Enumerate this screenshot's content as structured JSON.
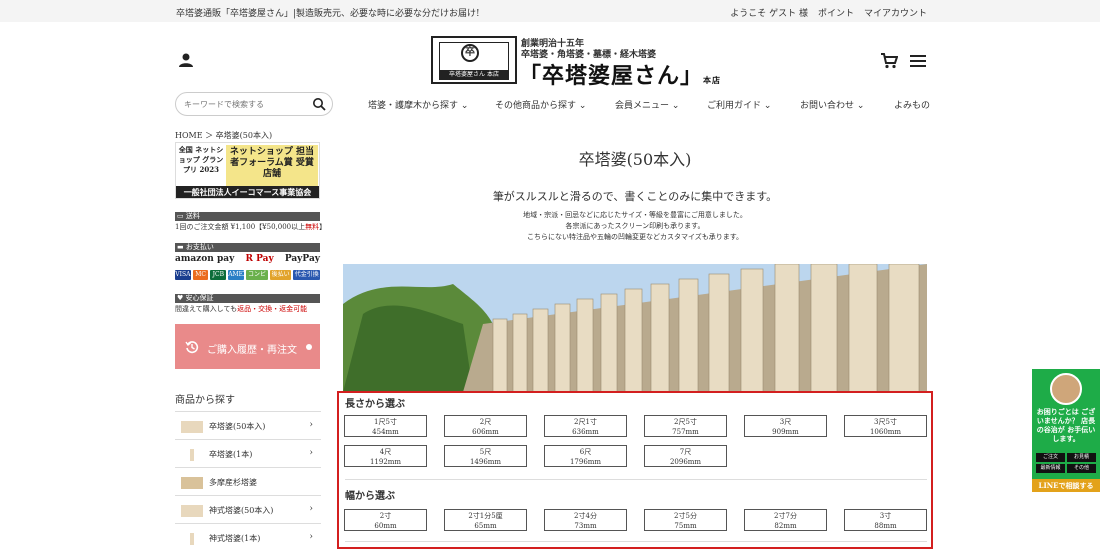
{
  "topbar": {
    "tagline": "卒塔婆通販「卒塔婆屋さん」|製造販売元、必要な時に必要な分だけお届け!",
    "welcome": "ようこそ ゲスト 様",
    "points": "ポイント",
    "my_account": "マイアカウント"
  },
  "logo": {
    "line1": "創業明治十五年",
    "line2": "卒塔婆・角塔婆・墓標・経木塔婆",
    "name": "「卒塔婆屋さん」",
    "suffix": "本店",
    "seal_text": "卒塔婆屋さん 本店",
    "seal_char": "卒"
  },
  "search": {
    "placeholder": "キーワードで検索する"
  },
  "nav": [
    {
      "label": "塔婆・護摩木から探す ⌄"
    },
    {
      "label": "その他商品から探す ⌄"
    },
    {
      "label": "会員メニュー ⌄"
    },
    {
      "label": "ご利用ガイド ⌄"
    },
    {
      "label": "お問い合わせ ⌄"
    },
    {
      "label": "よみもの"
    }
  ],
  "breadcrumb": "HOME ＞ 卒塔婆(50本入)",
  "award": {
    "left": "全国 ネットショップ グランプリ 2023",
    "badge": "ネットショップ 担当者フォーラム賞 受賞店舗",
    "foot": "一般社団法人イーコマース事業協会"
  },
  "sidebar": {
    "shipping_head": "送料",
    "shipping_text_a": "1回のご注文金額 ¥1,100【¥50,000以上",
    "shipping_text_b": "無料",
    "shipping_text_c": "】",
    "payment_head": "お支払い",
    "pay1": "amazon pay",
    "pay2": "R Pay",
    "pay3": "PayPay",
    "pay_mini": [
      "VISA",
      "MC",
      "JCB",
      "AMEX",
      "コンビニ",
      "後払い",
      "代金引換"
    ],
    "secure_head": "安心保証",
    "secure_text_a": "間違えて購入しても",
    "secure_text_b": "返品・交換・返金可能",
    "history_button": "ご購入履歴・再注文",
    "cat_title": "商品から探す",
    "categories": [
      {
        "label": "卒塔婆(50本入)"
      },
      {
        "label": "卒塔婆(1本)"
      },
      {
        "label": "多摩産杉塔婆"
      },
      {
        "label": "神式塔婆(50本入)"
      },
      {
        "label": "神式塔婆(1本)"
      }
    ]
  },
  "main": {
    "title": "卒塔婆(50本入)",
    "lead": "筆がスルスルと滑るので、書くことのみに集中できます。",
    "desc1": "地域・宗派・回忌などに応じたサイズ・等級を豊富にご用意しました。",
    "desc2": "各宗派にあったスクリーン印刷も承ります。",
    "desc3": "こちらにない特注品や五輪の凹輪変更などカスタマイズも承ります。"
  },
  "length_section": {
    "title": "長さから選ぶ",
    "options": [
      {
        "a": "1尺5寸",
        "b": "454mm"
      },
      {
        "a": "2尺",
        "b": "606mm"
      },
      {
        "a": "2尺1寸",
        "b": "636mm"
      },
      {
        "a": "2尺5寸",
        "b": "757mm"
      },
      {
        "a": "3尺",
        "b": "909mm"
      },
      {
        "a": "3尺5寸",
        "b": "1060mm"
      },
      {
        "a": "4尺",
        "b": "1192mm"
      },
      {
        "a": "5尺",
        "b": "1496mm"
      },
      {
        "a": "6尺",
        "b": "1796mm"
      },
      {
        "a": "7尺",
        "b": "2096mm"
      }
    ]
  },
  "width_section": {
    "title": "幅から選ぶ",
    "options": [
      {
        "a": "2寸",
        "b": "60mm"
      },
      {
        "a": "2寸1分5厘",
        "b": "65mm"
      },
      {
        "a": "2寸4分",
        "b": "73mm"
      },
      {
        "a": "2寸5分",
        "b": "75mm"
      },
      {
        "a": "2寸7分",
        "b": "82mm"
      },
      {
        "a": "3寸",
        "b": "88mm"
      }
    ]
  },
  "help": {
    "text": "お困りごとは ございませんか？ 店長の谷治が お手伝いします。",
    "links": [
      "ご注文",
      "お見積",
      "最新情報",
      "その他"
    ],
    "line_button": "LINEで相談する"
  },
  "colors": {
    "accent": "#d31f1f",
    "history": "#e98a8a",
    "line_green": "#1eac48"
  }
}
